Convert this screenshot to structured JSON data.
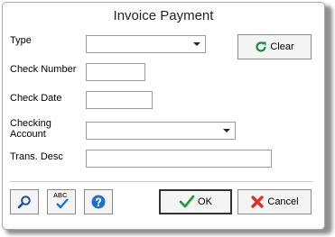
{
  "dialog": {
    "title": "Invoice Payment"
  },
  "form": {
    "type_label": "Type",
    "type_value": "",
    "check_number_label": "Check Number",
    "check_number_value": "",
    "check_date_label": "Check Date",
    "check_date_value": "",
    "checking_account_label_line1": "Checking",
    "checking_account_label_line2": "Account",
    "checking_account_value": "",
    "trans_desc_label": "Trans. Desc",
    "trans_desc_value": ""
  },
  "buttons": {
    "clear": "Clear",
    "ok": "OK",
    "cancel": "Cancel"
  },
  "toolbar": {
    "spell_icon_text": "ABC"
  },
  "icons": {
    "clear": "refresh-icon",
    "search": "search-icon",
    "spell": "spellcheck-icon",
    "help": "help-icon",
    "ok": "checkmark-icon",
    "cancel": "close-icon"
  },
  "colors": {
    "clear_icon": "#1e8a4a",
    "ok_check": "#2a9a3c",
    "cancel_x": "#d9342b",
    "help_blue": "#1e6fd0",
    "search_blue": "#1d4f9e"
  }
}
